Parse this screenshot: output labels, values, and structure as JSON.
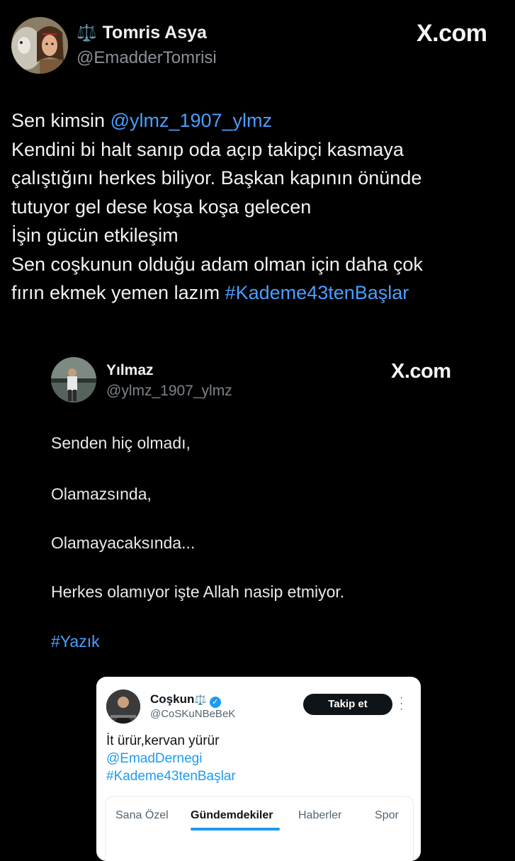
{
  "tweet": {
    "author_name": "Tomris Asya",
    "name_prefix_icon": "scales-icon",
    "handle": "@EmadderTomrisi",
    "source": "X.com",
    "lines": [
      {
        "text": "Sen kimsin ",
        "mention": "@ylmz_1907_ylmz",
        "after": ""
      },
      {
        "text": "Kendini bi halt sanıp oda açıp takipçi kasmaya"
      },
      {
        "text": "çalıştığını herkes biliyor. Başkan kapının önünde"
      },
      {
        "text": "tutuyor gel dese koşa koşa gelecen"
      },
      {
        "text": "İşin gücün etkileşim"
      },
      {
        "text": "Sen coşkunun olduğu adam olman için daha çok"
      },
      {
        "text": "fırın ekmek yemen lazım ",
        "hashtag": "#Kademe43tenBaşlar"
      }
    ]
  },
  "quoted": {
    "author_name": "Yılmaz",
    "handle": "@ylmz_1907_ylmz",
    "source": "X.com",
    "paragraphs": [
      "Senden hiç olmadı,",
      "Olamazsında,",
      "Olamayacaksında...",
      "Herkes olamıyor işte Allah nasip etmiyor.",
      "#Yazık"
    ]
  },
  "screenshot_card": {
    "author_name": "Coşkun",
    "name_suffix_icon": "scales-icon",
    "verified_badge": "verified-icon",
    "handle": "@CoSKuNBeBeK",
    "follow_label": "Takip et",
    "more_icon": "more-vertical-icon",
    "text": "İt ürür,kervan yürür",
    "mention": "@EmadDernegi",
    "hashtag": "#Kademe43tenBaşlar",
    "tabs": [
      {
        "label": "Sana Özel",
        "active": false
      },
      {
        "label": "Gündemdekiler",
        "active": true
      },
      {
        "label": "Haberler",
        "active": false
      },
      {
        "label": "Spor",
        "active": false
      }
    ]
  },
  "colors": {
    "background": "#000000",
    "text": "#e7e9ea",
    "secondary_text": "#8b9096",
    "link": "#4a9eff",
    "x_blue": "#1d9bf0"
  }
}
